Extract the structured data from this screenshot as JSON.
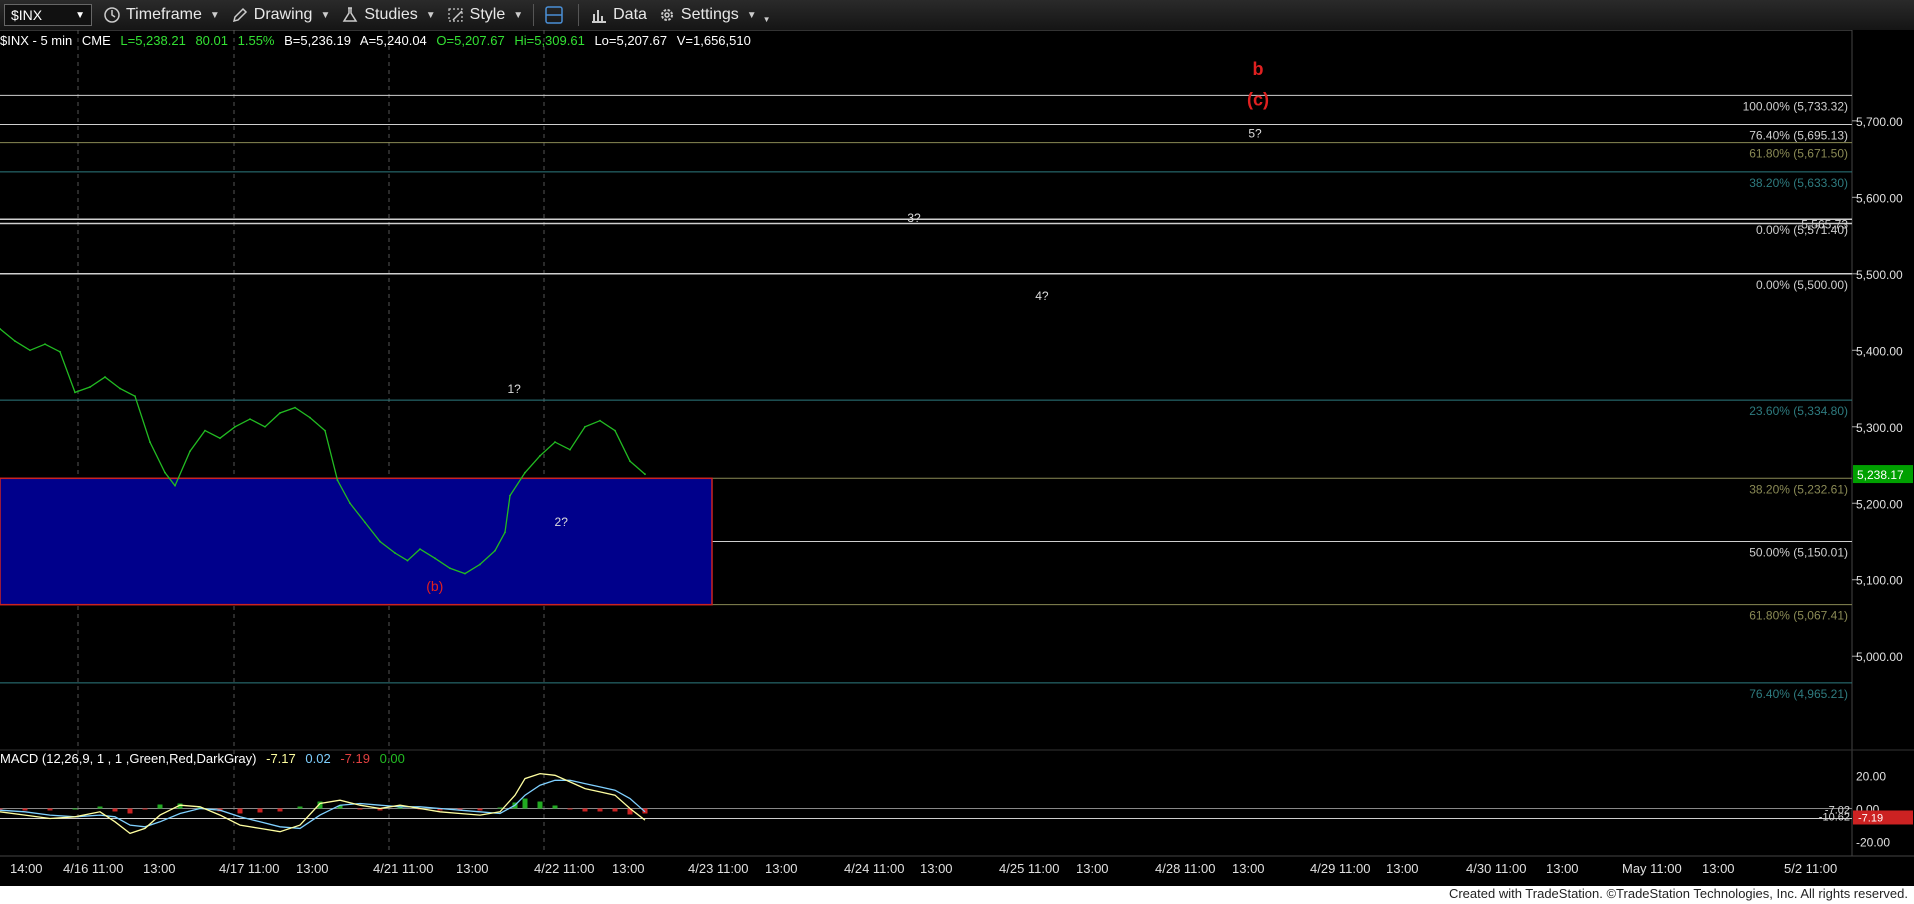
{
  "toolbar": {
    "symbol": "$INX",
    "items": [
      "Timeframe",
      "Drawing",
      "Studies",
      "Style",
      "Data",
      "Settings"
    ]
  },
  "quote": {
    "symbol_tf": "$INX - 5 min",
    "exchange": "CME",
    "last": "L=5,238.21",
    "change": "80.01",
    "pct": "1.55%",
    "bid": "B=5,236.19",
    "ask": "A=5,240.04",
    "open": "O=5,207.67",
    "high": "Hi=5,309.61",
    "low": "Lo=5,207.67",
    "volume": "V=1,656,510"
  },
  "colors": {
    "price_line": "#22bb22",
    "fib_teal": "#2e7b7f",
    "fib_olive": "#8a8a55",
    "fib_white": "#cfcfcf",
    "zone_fill": "#00008b",
    "zone_border": "#cc2222",
    "wave_red": "#e02020",
    "last_price_bg": "#00a000",
    "macd_line": "#ffffa0",
    "signal_line": "#7fd0ff"
  },
  "chart_data": {
    "type": "line",
    "title": "$INX - 5 min",
    "ylim": [
      4880,
      5790
    ],
    "y_ticks": [
      5000,
      5100,
      5200,
      5300,
      5400,
      5500,
      5600,
      5700
    ],
    "y_tick_labels": [
      "5,000.00",
      "5,100.00",
      "5,200.00",
      "5,300.00",
      "5,400.00",
      "5,500.00",
      "5,600.00",
      "5,700.00"
    ],
    "x_labels": [
      "14:00",
      "4/16 11:00",
      "13:00",
      "4/17 11:00",
      "13:00",
      "4/21 11:00",
      "13:00",
      "4/22 11:00",
      "13:00",
      "4/23 11:00",
      "13:00",
      "4/24 11:00",
      "13:00",
      "4/25 11:00",
      "13:00",
      "4/28 11:00",
      "13:00",
      "4/29 11:00",
      "13:00",
      "4/30 11:00",
      "13:00",
      "May 11:00",
      "13:00",
      "5/2 11:00"
    ],
    "session_dividers": [
      "4/16",
      "4/17",
      "4/21",
      "4/22"
    ],
    "last_price_label": "5,238.17",
    "series": [
      {
        "name": "$INX",
        "points": [
          [
            0,
            5428
          ],
          [
            6,
            5412
          ],
          [
            12,
            5400
          ],
          [
            18,
            5408
          ],
          [
            24,
            5398
          ],
          [
            30,
            5345
          ],
          [
            36,
            5352
          ],
          [
            42,
            5365
          ],
          [
            48,
            5350
          ],
          [
            54,
            5340
          ],
          [
            60,
            5280
          ],
          [
            66,
            5240
          ],
          [
            70,
            5223
          ],
          [
            76,
            5268
          ],
          [
            82,
            5295
          ],
          [
            88,
            5285
          ],
          [
            94,
            5300
          ],
          [
            100,
            5310
          ],
          [
            106,
            5300
          ],
          [
            112,
            5318
          ],
          [
            118,
            5325
          ],
          [
            124,
            5312
          ],
          [
            130,
            5295
          ],
          [
            135,
            5230
          ],
          [
            140,
            5200
          ],
          [
            146,
            5175
          ],
          [
            152,
            5150
          ],
          [
            158,
            5135
          ],
          [
            163,
            5125
          ],
          [
            168,
            5140
          ],
          [
            174,
            5128
          ],
          [
            180,
            5115
          ],
          [
            186,
            5108
          ],
          [
            192,
            5120
          ],
          [
            198,
            5138
          ],
          [
            202,
            5162
          ],
          [
            204,
            5210
          ],
          [
            210,
            5240
          ],
          [
            216,
            5262
          ],
          [
            222,
            5280
          ],
          [
            228,
            5270
          ],
          [
            234,
            5300
          ],
          [
            240,
            5308
          ],
          [
            246,
            5295
          ],
          [
            252,
            5255
          ],
          [
            258,
            5238
          ]
        ]
      }
    ],
    "fib_levels": [
      {
        "label": "100.00% (5,733.32)",
        "value": 5733.32,
        "style": "white"
      },
      {
        "label": "76.40% (5,695.13)",
        "value": 5695.13,
        "style": "white"
      },
      {
        "label": "61.80% (5,671.50)",
        "value": 5671.5,
        "style": "olive"
      },
      {
        "label": "38.20% (5,633.30)",
        "value": 5633.3,
        "style": "teal"
      },
      {
        "label": "0.00% (5,571.40)",
        "value": 5571.4,
        "style": "white"
      },
      {
        "label": "5,565.73",
        "value": 5565.73,
        "style": "white"
      },
      {
        "label": "0.00% (5,500.00)",
        "value": 5500.0,
        "style": "white"
      },
      {
        "label": "23.60% (5,334.80)",
        "value": 5334.8,
        "style": "teal"
      },
      {
        "label": "38.20% (5,232.61)",
        "value": 5232.61,
        "style": "olive"
      },
      {
        "label": "50.00% (5,150.01)",
        "value": 5150.01,
        "style": "white"
      },
      {
        "label": "61.80% (5,067.41)",
        "value": 5067.41,
        "style": "olive"
      },
      {
        "label": "76.40% (4,965.21)",
        "value": 4965.21,
        "style": "teal"
      }
    ],
    "zone": {
      "top": 5232.61,
      "bottom": 5067.41,
      "x_start": 0,
      "x_end": 410
    },
    "wave_labels": [
      {
        "text": "b",
        "x": 850,
        "y": 5760,
        "color": "red",
        "size": "big"
      },
      {
        "text": "(c)",
        "x": 850,
        "y": 5720,
        "color": "red",
        "size": "big"
      },
      {
        "text": "5?",
        "x": 848,
        "y": 5678,
        "color": "white",
        "size": "small"
      },
      {
        "text": "3?",
        "x": 616,
        "y": 5568,
        "color": "white",
        "size": "small"
      },
      {
        "text": "4?",
        "x": 703,
        "y": 5466,
        "color": "white",
        "size": "small"
      },
      {
        "text": "1?",
        "x": 344,
        "y": 5344,
        "color": "white",
        "size": "small"
      },
      {
        "text": "2?",
        "x": 376,
        "y": 5170,
        "color": "white",
        "size": "small"
      },
      {
        "text": "(b)",
        "x": 290,
        "y": 5085,
        "color": "red",
        "size": "mid"
      }
    ],
    "macd": {
      "label": "MACD (12,26,9, 1 , 1 ,Green,Red,DarkGray)",
      "values": [
        "-7.17",
        "0.02",
        "-7.19",
        "0.00"
      ],
      "ylim": [
        -25,
        28
      ],
      "y_ticks": [
        20,
        0,
        -20
      ],
      "y_tick_labels": [
        "20.00",
        "0.00",
        "-20.00"
      ],
      "right_labels": [
        "-7.02",
        "-10.62",
        "-7.19"
      ],
      "macd_line": [
        [
          0,
          -2
        ],
        [
          10,
          -4
        ],
        [
          20,
          -6
        ],
        [
          30,
          -5
        ],
        [
          40,
          -2
        ],
        [
          46,
          -8
        ],
        [
          52,
          -15
        ],
        [
          58,
          -12
        ],
        [
          64,
          -4
        ],
        [
          72,
          2
        ],
        [
          80,
          1
        ],
        [
          88,
          -4
        ],
        [
          96,
          -10
        ],
        [
          104,
          -12
        ],
        [
          112,
          -14
        ],
        [
          120,
          -10
        ],
        [
          128,
          3
        ],
        [
          136,
          5
        ],
        [
          144,
          2
        ],
        [
          152,
          0
        ],
        [
          160,
          2
        ],
        [
          168,
          0
        ],
        [
          176,
          -2
        ],
        [
          184,
          -3
        ],
        [
          192,
          -4
        ],
        [
          200,
          -2
        ],
        [
          206,
          8
        ],
        [
          210,
          18
        ],
        [
          216,
          21
        ],
        [
          222,
          20
        ],
        [
          228,
          16
        ],
        [
          234,
          12
        ],
        [
          240,
          10
        ],
        [
          246,
          8
        ],
        [
          252,
          0
        ],
        [
          258,
          -7
        ]
      ],
      "signal_line": [
        [
          0,
          -1
        ],
        [
          10,
          -2
        ],
        [
          20,
          -4
        ],
        [
          30,
          -5
        ],
        [
          40,
          -4
        ],
        [
          46,
          -5
        ],
        [
          52,
          -10
        ],
        [
          58,
          -11
        ],
        [
          64,
          -8
        ],
        [
          72,
          -3
        ],
        [
          80,
          0
        ],
        [
          88,
          -1
        ],
        [
          96,
          -5
        ],
        [
          104,
          -8
        ],
        [
          112,
          -11
        ],
        [
          120,
          -12
        ],
        [
          128,
          -4
        ],
        [
          136,
          2
        ],
        [
          144,
          3
        ],
        [
          152,
          2
        ],
        [
          160,
          1
        ],
        [
          168,
          1
        ],
        [
          176,
          0
        ],
        [
          184,
          -1
        ],
        [
          192,
          -2
        ],
        [
          200,
          -3
        ],
        [
          206,
          2
        ],
        [
          210,
          8
        ],
        [
          216,
          14
        ],
        [
          222,
          17
        ],
        [
          228,
          17
        ],
        [
          234,
          15
        ],
        [
          240,
          13
        ],
        [
          246,
          11
        ],
        [
          252,
          6
        ],
        [
          258,
          -2
        ]
      ]
    }
  },
  "footer": "Created with TradeStation. ©TradeStation Technologies, Inc. All rights reserved."
}
